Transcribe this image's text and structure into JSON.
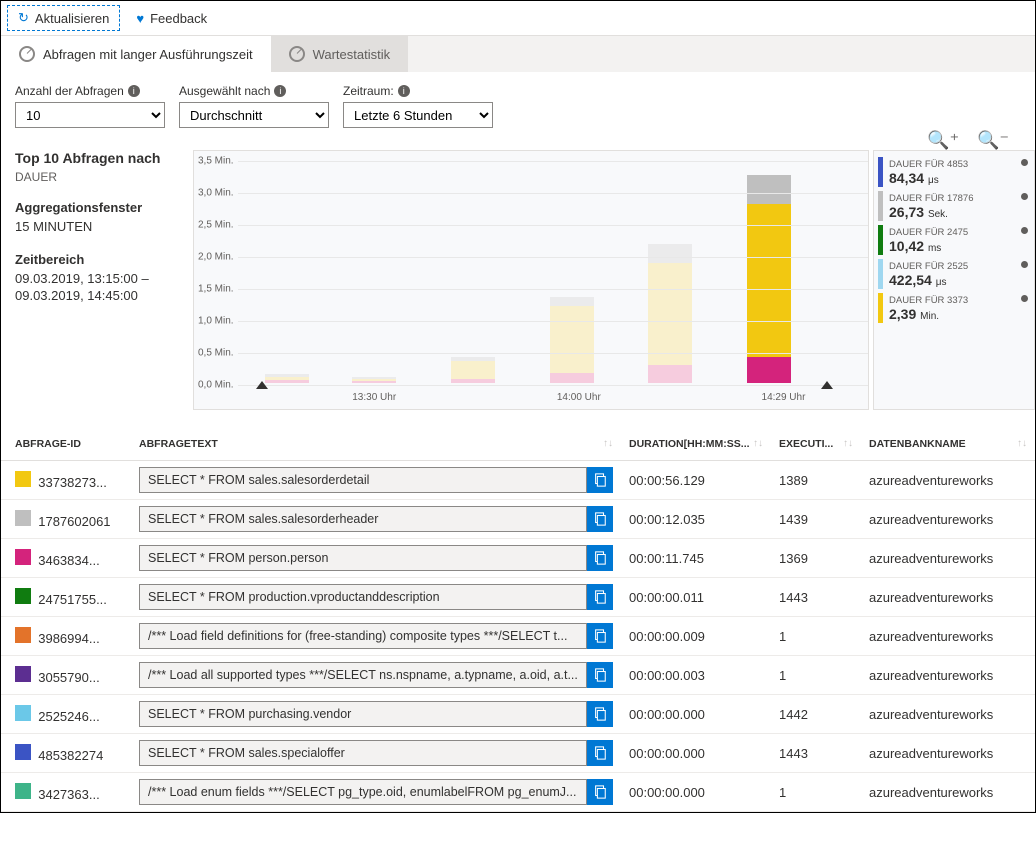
{
  "toolbar": {
    "refresh_label": "Aktualisieren",
    "feedback_label": "Feedback"
  },
  "tabs": {
    "long_running": "Abfragen mit langer Ausführungszeit",
    "wait_stats": "Wartestatistik"
  },
  "filters": {
    "count_label": "Anzahl der Abfragen",
    "count_value": "10",
    "selected_label": "Ausgewählt nach",
    "selected_value": "Durchschnitt",
    "period_label": "Zeitraum:",
    "period_value": "Letzte 6 Stunden"
  },
  "sidebar": {
    "top_label": "Top 10 Abfragen nach",
    "metric": "DAUER",
    "agg_label": "Aggregationsfenster",
    "agg_value": "15 MINUTEN",
    "range_label": "Zeitbereich",
    "range_value": "09.03.2019, 13:15:00 – 09.03.2019, 14:45:00"
  },
  "legend": [
    {
      "label": "DAUER FÜR 4853",
      "value": "84,34",
      "unit": "μs",
      "color": "#3b54c4"
    },
    {
      "label": "DAUER FÜR 17876",
      "value": "26,73",
      "unit": "Sek.",
      "color": "#bfbfbf"
    },
    {
      "label": "DAUER FÜR 2475",
      "value": "10,42",
      "unit": "ms",
      "color": "#107c10"
    },
    {
      "label": "DAUER FÜR 2525",
      "value": "422,54",
      "unit": "μs",
      "color": "#9fd7f0"
    },
    {
      "label": "DAUER FÜR 3373",
      "value": "2,39",
      "unit": "Min.",
      "color": "#f2c811"
    }
  ],
  "columns": {
    "id": "ABFRAGE-ID",
    "text": "ABFRAGETEXT",
    "duration": "DURATION[HH:MM:SS...",
    "exec": "EXECUTI...",
    "db": "DATENBANKNAME"
  },
  "rows": [
    {
      "color": "#f2c811",
      "id": "33738273...",
      "text": "SELECT * FROM sales.salesorderdetail",
      "duration": "00:00:56.129",
      "exec": "1389",
      "db": "azureadventureworks"
    },
    {
      "color": "#bfbfbf",
      "id": "1787602061",
      "text": "SELECT * FROM sales.salesorderheader",
      "duration": "00:00:12.035",
      "exec": "1439",
      "db": "azureadventureworks"
    },
    {
      "color": "#d4237c",
      "id": "3463834...",
      "text": "SELECT * FROM person.person",
      "duration": "00:00:11.745",
      "exec": "1369",
      "db": "azureadventureworks"
    },
    {
      "color": "#107c10",
      "id": "24751755...",
      "text": "SELECT * FROM production.vproductanddescription",
      "duration": "00:00:00.011",
      "exec": "1443",
      "db": "azureadventureworks"
    },
    {
      "color": "#e3732a",
      "id": "3986994...",
      "text": "/*** Load field definitions for (free-standing) composite types ***/SELECT t...",
      "duration": "00:00:00.009",
      "exec": "1",
      "db": "azureadventureworks"
    },
    {
      "color": "#5c2e91",
      "id": "3055790...",
      "text": "/*** Load all supported types ***/SELECT ns.nspname, a.typname, a.oid, a.t...",
      "duration": "00:00:00.003",
      "exec": "1",
      "db": "azureadventureworks"
    },
    {
      "color": "#6bc8e8",
      "id": "2525246...",
      "text": "SELECT * FROM purchasing.vendor",
      "duration": "00:00:00.000",
      "exec": "1442",
      "db": "azureadventureworks"
    },
    {
      "color": "#3b54c4",
      "id": "485382274",
      "text": "SELECT * FROM sales.specialoffer",
      "duration": "00:00:00.000",
      "exec": "1443",
      "db": "azureadventureworks"
    },
    {
      "color": "#3eb489",
      "id": "3427363...",
      "text": "/*** Load enum fields ***/SELECT pg_type.oid, enumlabelFROM pg_enumJ...",
      "duration": "00:00:00.000",
      "exec": "1",
      "db": "azureadventureworks"
    }
  ],
  "chart_data": {
    "type": "bar",
    "ylabel_unit": "Min.",
    "ylim": [
      0,
      3.5
    ],
    "yticks": [
      "0,0 Min.",
      "0,5 Min.",
      "1,0 Min.",
      "1,5 Min.",
      "2,0 Min.",
      "2,5 Min.",
      "3,0 Min.",
      "3,5 Min."
    ],
    "xticks": [
      "13:30 Uhr",
      "14:00 Uhr",
      "14:29 Uhr"
    ],
    "xtick_pos_pct": [
      21,
      54,
      87
    ],
    "bars": [
      {
        "x_pct": 7,
        "segments": [
          {
            "c": "#f4a7c6",
            "h": 0.05
          },
          {
            "c": "#f9e9a6",
            "h": 0.05
          },
          {
            "c": "#e0e0e0",
            "h": 0.04
          }
        ],
        "faded": true
      },
      {
        "x_pct": 21,
        "segments": [
          {
            "c": "#f4a7c6",
            "h": 0.03
          },
          {
            "c": "#f9e9a6",
            "h": 0.03
          },
          {
            "c": "#e0e0e0",
            "h": 0.03
          }
        ],
        "faded": true
      },
      {
        "x_pct": 37,
        "segments": [
          {
            "c": "#f4a7c6",
            "h": 0.06
          },
          {
            "c": "#f9e9a6",
            "h": 0.28
          },
          {
            "c": "#e0e0e0",
            "h": 0.06
          }
        ],
        "faded": true
      },
      {
        "x_pct": 53,
        "segments": [
          {
            "c": "#f4a7c6",
            "h": 0.15
          },
          {
            "c": "#f9e9a6",
            "h": 1.05
          },
          {
            "c": "#e0e0e0",
            "h": 0.15
          }
        ],
        "faded": true
      },
      {
        "x_pct": 69,
        "segments": [
          {
            "c": "#f4a7c6",
            "h": 0.28
          },
          {
            "c": "#f9e9a6",
            "h": 1.6
          },
          {
            "c": "#e0e0e0",
            "h": 0.3
          }
        ],
        "faded": true
      },
      {
        "x_pct": 85,
        "segments": [
          {
            "c": "#d4237c",
            "h": 0.4
          },
          {
            "c": "#f2c811",
            "h": 2.4
          },
          {
            "c": "#bfbfbf",
            "h": 0.45
          }
        ],
        "faded": false
      }
    ],
    "triangles_pct": [
      2,
      93
    ]
  }
}
